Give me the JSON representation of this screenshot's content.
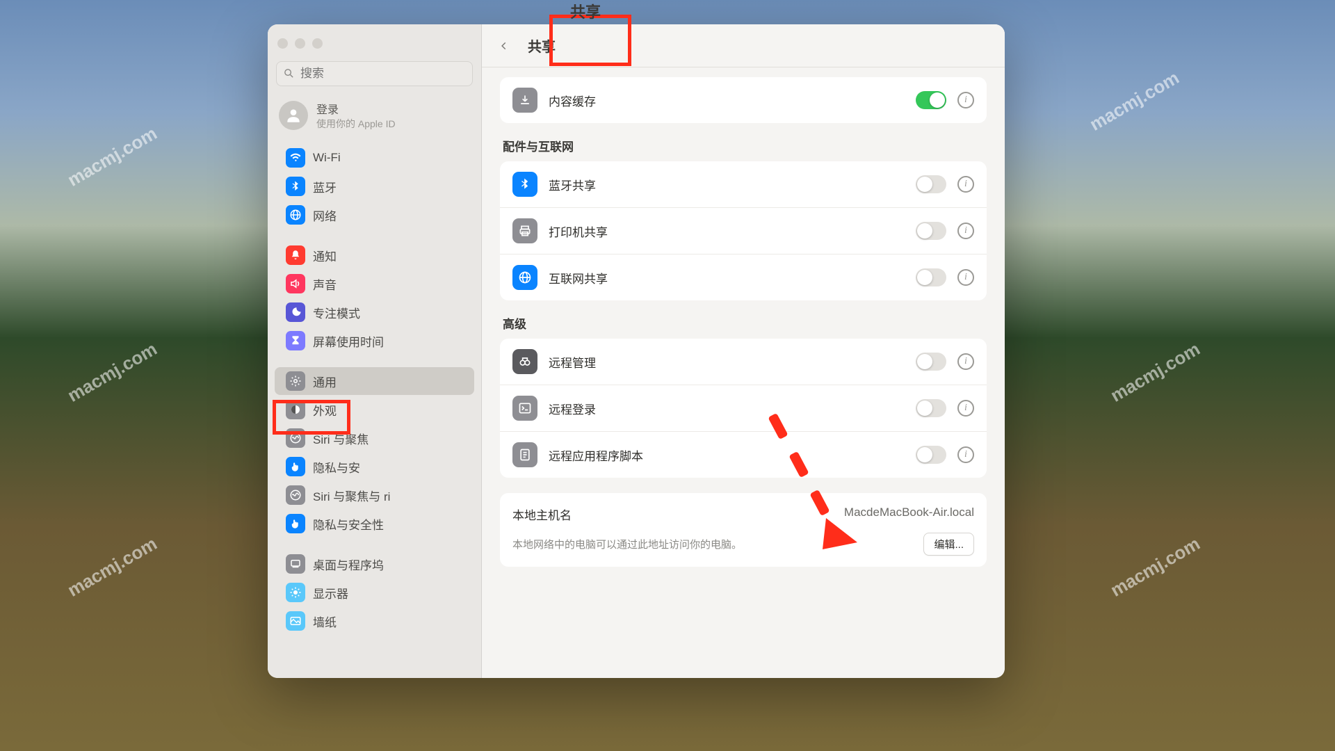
{
  "watermark": "macmj.com",
  "window": {
    "title": "共享",
    "search_placeholder": "搜索",
    "account": {
      "login": "登录",
      "sub": "使用你的 Apple ID"
    }
  },
  "sidebar": {
    "items": [
      {
        "label": "Wi-Fi",
        "color": "ic-blue",
        "icon": "wifi"
      },
      {
        "label": "蓝牙",
        "color": "ic-blue",
        "icon": "bt"
      },
      {
        "label": "网络",
        "color": "ic-blue",
        "icon": "globe"
      },
      {
        "label": "通知",
        "color": "ic-red",
        "icon": "bell",
        "gapBefore": true
      },
      {
        "label": "声音",
        "color": "ic-pink",
        "icon": "speaker"
      },
      {
        "label": "专注模式",
        "color": "ic-purple",
        "icon": "moon"
      },
      {
        "label": "屏幕使用时间",
        "color": "ic-lav",
        "icon": "hourglass"
      },
      {
        "label": "通用",
        "color": "ic-grey",
        "icon": "gear",
        "gapBefore": true,
        "selected": true
      },
      {
        "label": "外观",
        "color": "ic-grey",
        "icon": "appearance"
      },
      {
        "label": "Siri 与聚焦",
        "color": "ic-grey",
        "icon": "siri"
      },
      {
        "label": "隐私与安",
        "color": "ic-blue",
        "icon": "hand"
      },
      {
        "label": "Siri 与聚焦与 ri",
        "color": "ic-grey",
        "icon": "siri"
      },
      {
        "label": "隐私与安全性",
        "color": "ic-blue",
        "icon": "hand"
      },
      {
        "label": "桌面与程序坞",
        "color": "ic-grey",
        "icon": "dock",
        "gapBefore": true
      },
      {
        "label": "显示器",
        "color": "ic-teal",
        "icon": "sun"
      },
      {
        "label": "墙纸",
        "color": "ic-teal",
        "icon": "wall"
      }
    ]
  },
  "groups": [
    {
      "title": null,
      "rows": [
        {
          "label": "内容缓存",
          "icon": "download",
          "iconClass": "ric-grey",
          "on": true
        }
      ]
    },
    {
      "title": "配件与互联网",
      "rows": [
        {
          "label": "蓝牙共享",
          "icon": "bt",
          "iconClass": "ric-blue",
          "on": false
        },
        {
          "label": "打印机共享",
          "icon": "printer",
          "iconClass": "ric-grey",
          "on": false
        },
        {
          "label": "互联网共享",
          "icon": "globe",
          "iconClass": "ric-blue",
          "on": false
        }
      ]
    },
    {
      "title": "高级",
      "rows": [
        {
          "label": "远程管理",
          "icon": "binoc",
          "iconClass": "ric-dark",
          "on": false
        },
        {
          "label": "远程登录",
          "icon": "terminal",
          "iconClass": "ric-grey",
          "on": false
        },
        {
          "label": "远程应用程序脚本",
          "icon": "script",
          "iconClass": "ric-grey",
          "on": false
        }
      ]
    }
  ],
  "host": {
    "label": "本地主机名",
    "value": "MacdeMacBook-Air.local",
    "desc": "本地网络中的电脑可以通过此地址访问你的电脑。",
    "edit": "编辑..."
  }
}
